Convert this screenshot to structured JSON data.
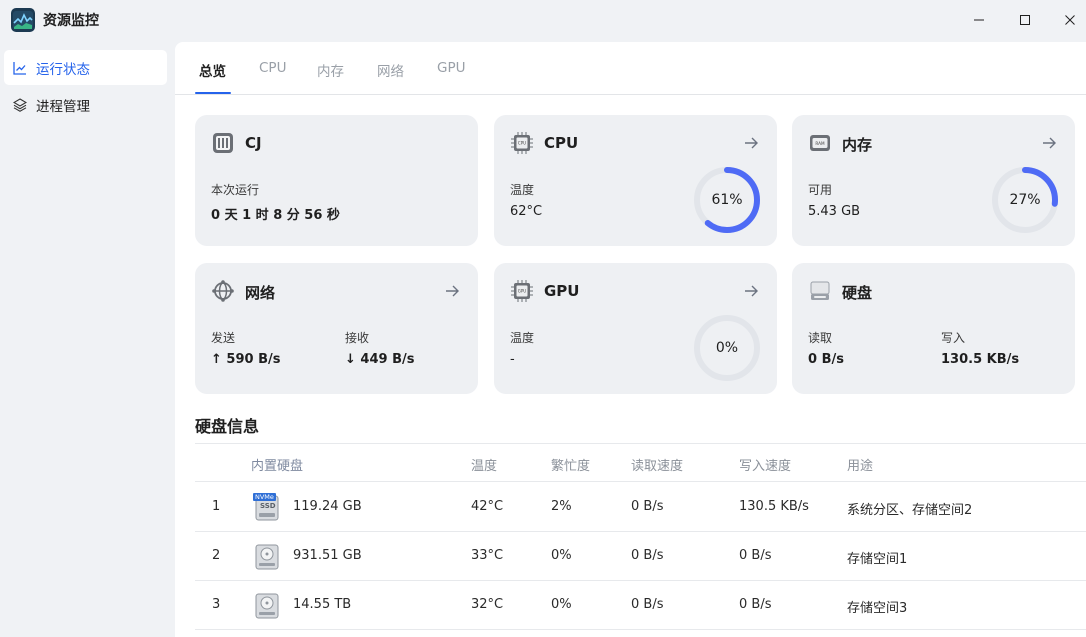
{
  "app": {
    "title": "资源监控"
  },
  "sidebar": {
    "items": [
      {
        "label": "运行状态",
        "icon": "chart-line-icon",
        "active": true
      },
      {
        "label": "进程管理",
        "icon": "layers-icon",
        "active": false
      }
    ]
  },
  "tabs": [
    {
      "label": "总览",
      "active": true
    },
    {
      "label": "CPU"
    },
    {
      "label": "内存"
    },
    {
      "label": "网络"
    },
    {
      "label": "GPU"
    }
  ],
  "cards": {
    "cj": {
      "title": "CJ",
      "uptime_label": "本次运行",
      "uptime_value": "0 天 1 时 8 分 56 秒"
    },
    "cpu": {
      "title": "CPU",
      "temp_label": "温度",
      "temp_value": "62°C",
      "usage_text": "61%",
      "usage": 0.61
    },
    "memory": {
      "title": "内存",
      "available_label": "可用",
      "available_value": "5.43 GB",
      "usage_text": "27%",
      "usage": 0.27
    },
    "network": {
      "title": "网络",
      "send_label": "发送",
      "send_value": "↑ 590 B/s",
      "recv_label": "接收",
      "recv_value": "↓ 449 B/s"
    },
    "gpu": {
      "title": "GPU",
      "temp_label": "温度",
      "temp_value": "-",
      "usage_text": "0%",
      "usage": 0
    },
    "disk": {
      "title": "硬盘",
      "read_label": "读取",
      "read_value": "0 B/s",
      "write_label": "写入",
      "write_value": "130.5 KB/s"
    }
  },
  "disk_info": {
    "title": "硬盘信息",
    "columns": [
      "内置硬盘",
      "温度",
      "繁忙度",
      "读取速度",
      "写入速度",
      "用途"
    ],
    "rows": [
      {
        "index": "1",
        "size": "119.24 GB",
        "temp": "42°C",
        "busy": "2%",
        "read": "0 B/s",
        "write": "130.5 KB/s",
        "usage": "系统分区、存储空间2",
        "badge": "NVMe",
        "ssd": "SSD"
      },
      {
        "index": "2",
        "size": "931.51 GB",
        "temp": "33°C",
        "busy": "0%",
        "read": "0 B/s",
        "write": "0 B/s",
        "usage": "存储空间1"
      },
      {
        "index": "3",
        "size": "14.55 TB",
        "temp": "32°C",
        "busy": "0%",
        "read": "0 B/s",
        "write": "0 B/s",
        "usage": "存储空间3"
      }
    ]
  },
  "colors": {
    "accent": "#2563eb",
    "gauge_fill": "#4f6bf5",
    "gauge_track": "#e2e5ea",
    "card_bg": "#eef0f3"
  }
}
